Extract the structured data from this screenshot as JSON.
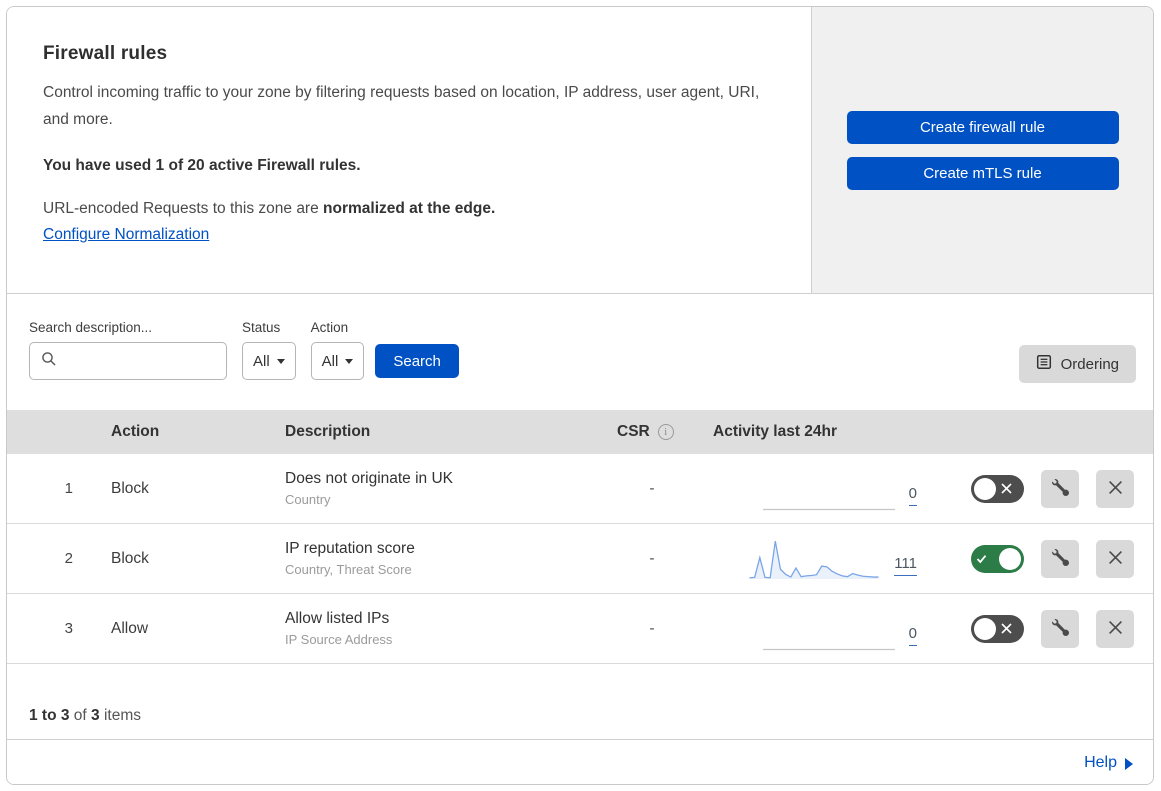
{
  "header": {
    "title": "Firewall rules",
    "description": "Control incoming traffic to your zone by filtering requests based on location, IP address, user agent, URI, and more.",
    "usage_notice": "You have used 1 of 20 active Firewall rules.",
    "normalization_prefix": "URL-encoded Requests to this zone are ",
    "normalization_bold": "normalized at the edge.",
    "normalization_link": "Configure Normalization",
    "create_firewall_button": "Create firewall rule",
    "create_mtls_button": "Create mTLS rule"
  },
  "filters": {
    "search_label": "Search description...",
    "status_label": "Status",
    "status_value": "All",
    "action_label": "Action",
    "action_value": "All",
    "search_button": "Search",
    "ordering_button": "Ordering"
  },
  "table": {
    "columns": {
      "action": "Action",
      "description": "Description",
      "csr": "CSR",
      "activity": "Activity last 24hr"
    },
    "rows": [
      {
        "priority": "1",
        "action": "Block",
        "description": "Does not originate in UK",
        "fields": "Country",
        "csr": "-",
        "activity_count": "0",
        "enabled": false,
        "sparkline": []
      },
      {
        "priority": "2",
        "action": "Block",
        "description": "IP reputation score",
        "fields": "Country, Threat Score",
        "csr": "-",
        "activity_count": "111",
        "enabled": true,
        "sparkline": [
          3,
          4,
          55,
          4,
          3,
          97,
          25,
          12,
          5,
          28,
          6,
          8,
          9,
          11,
          33,
          31,
          20,
          13,
          8,
          6,
          14,
          10,
          7,
          6,
          5,
          5
        ]
      },
      {
        "priority": "3",
        "action": "Allow",
        "description": "Allow listed IPs",
        "fields": "IP Source Address",
        "csr": "-",
        "activity_count": "0",
        "enabled": false,
        "sparkline": []
      }
    ],
    "footer": {
      "range_bold": "1 to 3",
      "of_text": " of ",
      "total_bold": "3",
      "items_text": " items"
    }
  },
  "help": {
    "label": "Help"
  },
  "icons": {
    "search-icon": "magnifier",
    "info-icon": "circled-i",
    "ordering-icon": "list-box",
    "wrench-icon": "wrench",
    "delete-icon": "x-cross",
    "toggle-off-icon": "x-cross",
    "toggle-on-icon": "checkmark",
    "dropdown-caret-icon": "down-triangle",
    "help-arrow-icon": "right-triangle"
  },
  "colors": {
    "primary_blue": "#0051c3",
    "toggle_green": "#2c7c47",
    "toggle_gray": "#4d4d4d",
    "panel_gray": "#f0f0f0",
    "table_header_gray": "#dedede",
    "sparkline_blue": "#7aa5e8"
  }
}
